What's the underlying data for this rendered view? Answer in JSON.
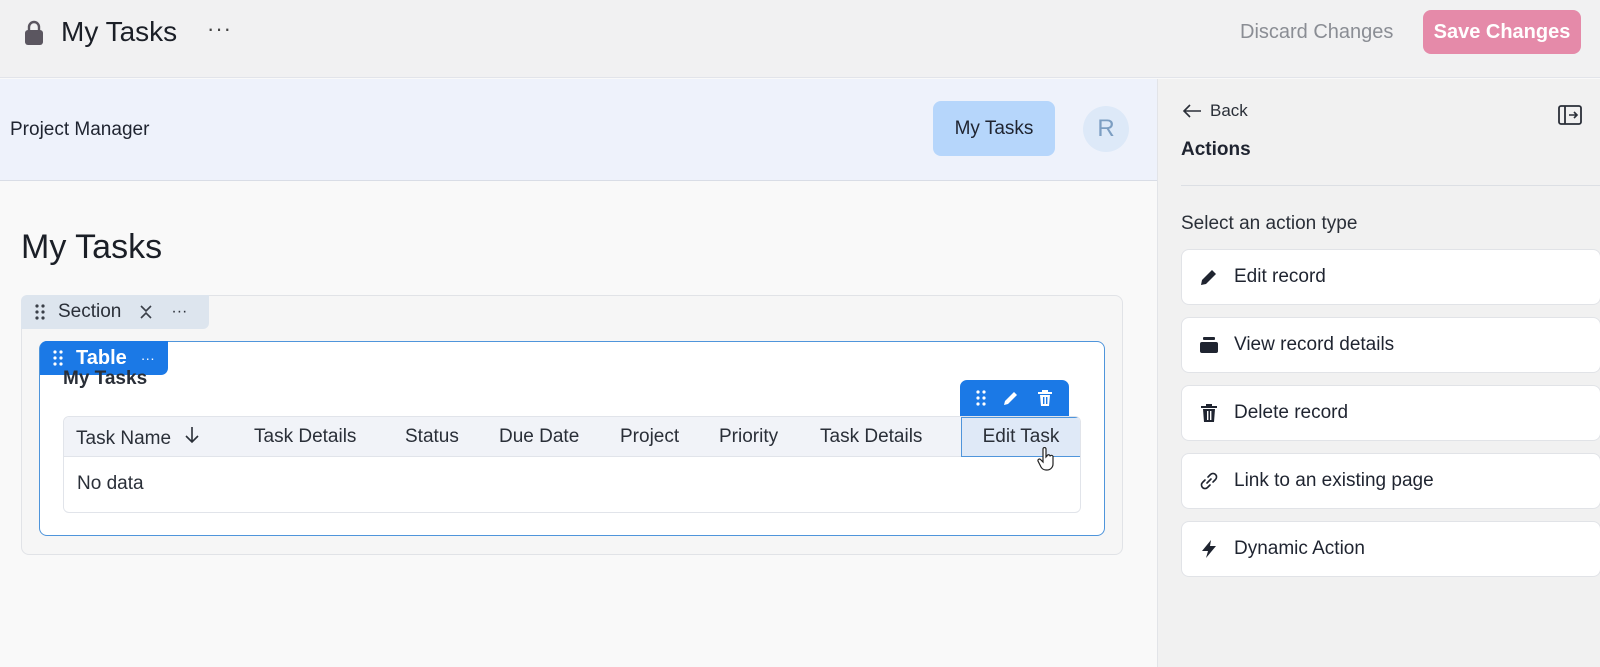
{
  "topbar": {
    "page_name": "My Tasks",
    "more_label": "···",
    "discard_label": "Discard Changes",
    "save_label": "Save Changes"
  },
  "app_header": {
    "app_name": "Project Manager",
    "nav_item": "My Tasks",
    "avatar_initial": "R"
  },
  "content": {
    "page_title": "My Tasks",
    "section": {
      "label": "Section",
      "more_label": "···"
    },
    "table": {
      "tab_label": "Table",
      "more_label": "···",
      "title": "My Tasks",
      "columns": [
        "Task Name",
        "Task Details",
        "Status",
        "Due Date",
        "Project",
        "Priority",
        "Task Details",
        "Edit Task"
      ],
      "empty_text": "No data"
    }
  },
  "panel": {
    "back_label": "Back",
    "title": "Actions",
    "prompt": "Select an action type",
    "actions": [
      {
        "label": "Edit record",
        "icon": "pencil-icon"
      },
      {
        "label": "View record details",
        "icon": "record-details-icon"
      },
      {
        "label": "Delete record",
        "icon": "trash-icon"
      },
      {
        "label": "Link to an existing page",
        "icon": "link-icon"
      },
      {
        "label": "Dynamic Action",
        "icon": "bolt-icon"
      }
    ]
  },
  "colors": {
    "accent": "#1b79e6",
    "save_button": "#e58aa9",
    "nav_pill": "#b6d6fb",
    "header_bg": "#eef2fb"
  }
}
